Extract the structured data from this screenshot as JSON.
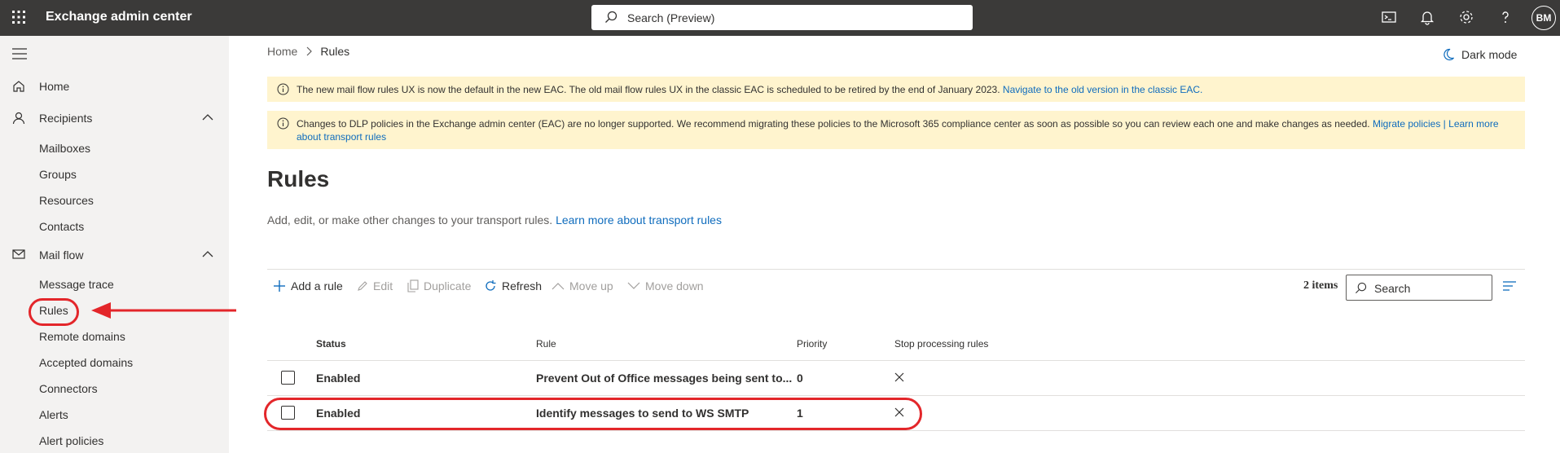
{
  "topbar": {
    "app_title": "Exchange admin center",
    "search_placeholder": "Search (Preview)",
    "avatar_initials": "BM"
  },
  "sidebar": {
    "items": [
      {
        "label": "Home",
        "icon": "home-icon"
      },
      {
        "label": "Recipients",
        "icon": "person-icon",
        "expanded": true
      },
      {
        "label": "Mail flow",
        "icon": "mail-icon",
        "expanded": true
      }
    ],
    "recipients_sub": [
      "Mailboxes",
      "Groups",
      "Resources",
      "Contacts"
    ],
    "mailflow_sub": [
      "Message trace",
      "Rules",
      "Remote domains",
      "Accepted domains",
      "Connectors",
      "Alerts",
      "Alert policies"
    ],
    "selected": "Rules"
  },
  "breadcrumb": {
    "home": "Home",
    "current": "Rules"
  },
  "dark_mode_label": "Dark mode",
  "banners": {
    "banner1_text": "The new mail flow rules UX is now the default in the new EAC. The old mail flow rules UX in the classic EAC is scheduled to be retired by the end of January 2023.",
    "banner1_link": "Navigate to the old version in the classic EAC.",
    "banner2_text": "Changes to DLP policies in the Exchange admin center (EAC) are no longer supported. We recommend migrating these policies to the Microsoft 365 compliance center as soon as possible so you can review each one and make changes as needed.",
    "banner2_link1": "Migrate policies |",
    "banner2_link2": "Learn more about transport rules"
  },
  "page": {
    "title": "Rules",
    "description": "Add, edit, or make other changes to your transport rules.",
    "description_link": "Learn more about transport rules"
  },
  "commands": {
    "add": "Add a rule",
    "edit": "Edit",
    "duplicate": "Duplicate",
    "refresh": "Refresh",
    "move_up": "Move up",
    "move_down": "Move down",
    "items_count": "2 items",
    "search_placeholder": "Search"
  },
  "table": {
    "columns": [
      "Status",
      "Rule",
      "Priority",
      "Stop processing rules"
    ],
    "rows": [
      {
        "status": "Enabled",
        "rule": "Prevent Out of Office messages being sent to...",
        "priority": "0",
        "stop": "x"
      },
      {
        "status": "Enabled",
        "rule": "Identify messages to send to WS SMTP",
        "priority": "1",
        "stop": "x"
      }
    ]
  },
  "colors": {
    "topbar": "#3b3a39",
    "sidebar": "#f3f2f1",
    "banner": "#fff4ce",
    "link": "#0f6cbd",
    "annotation": "#e3262a"
  }
}
